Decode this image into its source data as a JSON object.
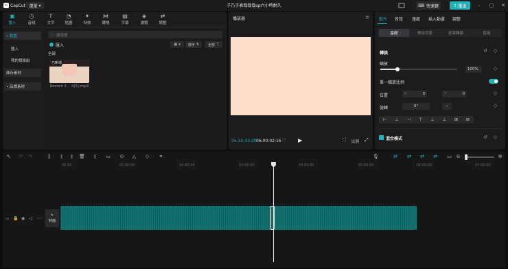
{
  "app": {
    "logo_text": "CapCut",
    "menu_label": "選單",
    "title": "子乃子表哉哉哉op六小時耐久",
    "shortcut_label": "快速鍵",
    "export_label": "匯出"
  },
  "media": {
    "tabs": [
      {
        "label": "匯入",
        "icon": "import-icon"
      },
      {
        "label": "音頻",
        "icon": "audio-icon"
      },
      {
        "label": "文字",
        "icon": "text-icon"
      },
      {
        "label": "貼圖",
        "icon": "sticker-icon"
      },
      {
        "label": "特效",
        "icon": "effects-icon"
      },
      {
        "label": "轉場",
        "icon": "transition-icon"
      },
      {
        "label": "字幕",
        "icon": "caption-icon"
      },
      {
        "label": "濾鏡",
        "icon": "filter-icon"
      },
      {
        "label": "調整",
        "icon": "adjust-icon"
      }
    ],
    "side_nav": [
      "• 裝置",
      "匯入",
      "我的預設組",
      "庫存素材",
      "• 品牌素材"
    ],
    "search_placeholder": "搜尋檔",
    "import_label": "匯入",
    "sort_label": "排序",
    "filter_label": "全部",
    "all_label": "全部",
    "thumb": {
      "badge": "已新增",
      "duration": "",
      "name": "Record 2... 4(5).mp4"
    }
  },
  "player": {
    "title": "播放器",
    "timecode_current": "05:35:43:20",
    "timecode_duration": "06:00:02:16",
    "ratio_label": "比例"
  },
  "props": {
    "tabs": [
      "影片",
      "音效",
      "速度",
      "插入動畫",
      "調整"
    ],
    "subtabs": [
      "基礎",
      "移除背景",
      "遮罩轉換",
      "智能"
    ],
    "transform_label": "轉換",
    "scale_label": "縮放",
    "scale_value": "100%",
    "scale_fraction": 0.22,
    "uniform_label": "單一縮放比例",
    "position_label": "位置",
    "pos_x_label": "X",
    "pos_x_value": "0",
    "pos_y_label": "Y",
    "pos_y_value": "0",
    "rotate_label": "旋轉",
    "rotate_value": "0°",
    "blend_label": "混合模式"
  },
  "timeline": {
    "ruler": [
      "00:00",
      "01:00:00",
      "02:00:00",
      "03:00:00",
      "04:00:00",
      "05:00:00",
      "06:00:00",
      "07:00:00"
    ],
    "cover_label": "封面"
  }
}
